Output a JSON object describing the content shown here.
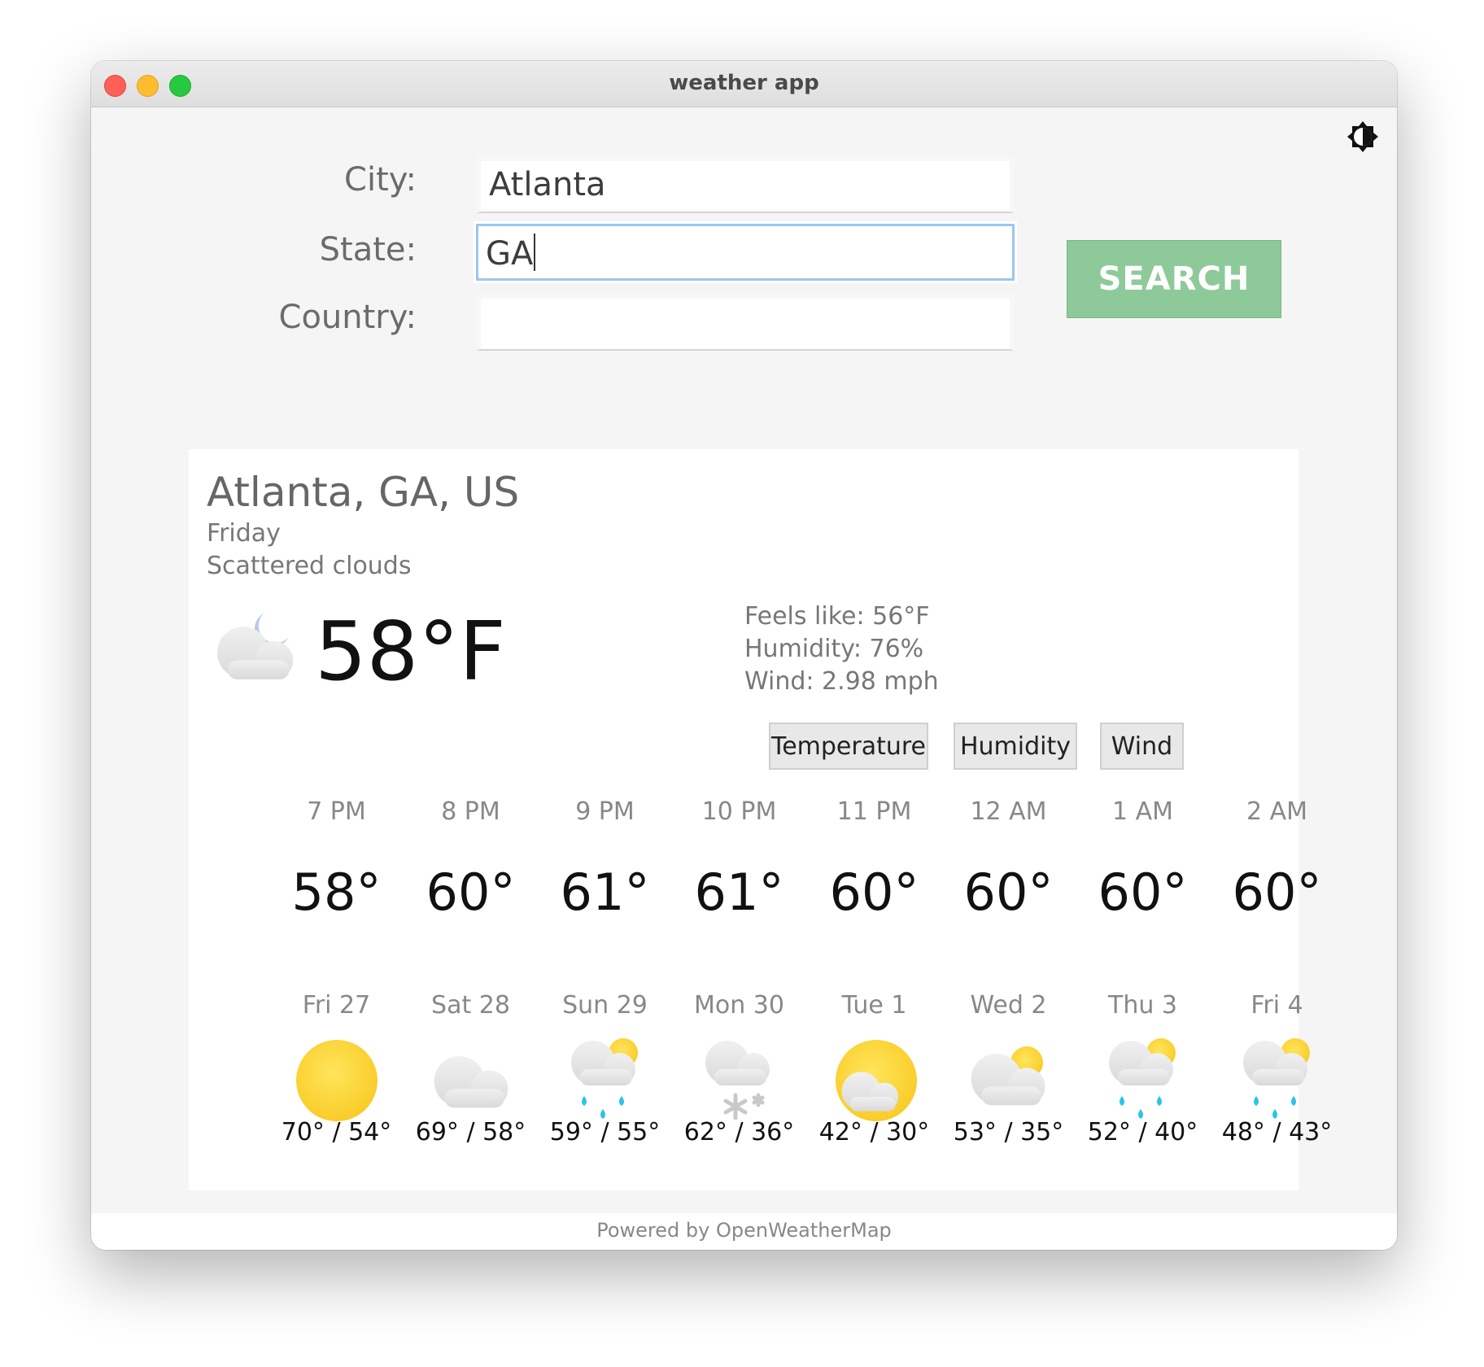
{
  "window": {
    "title": "weather app"
  },
  "form": {
    "city_label": "City:",
    "city_value": "Atlanta",
    "state_label": "State:",
    "state_value": "GA",
    "country_label": "Country:",
    "country_value": "",
    "search_label": "SEARCH"
  },
  "current": {
    "location": "Atlanta, GA, US",
    "day": "Friday",
    "condition": "Scattered clouds",
    "icon": "night-cloud-icon",
    "temp": "58°F",
    "feels_like": "Feels like: 56°F",
    "humidity": "Humidity: 76%",
    "wind": "Wind: 2.98 mph"
  },
  "tabs": [
    "Temperature",
    "Humidity",
    "Wind"
  ],
  "hourly": [
    {
      "time": "7 PM",
      "temp": "58°"
    },
    {
      "time": "8 PM",
      "temp": "60°"
    },
    {
      "time": "9 PM",
      "temp": "61°"
    },
    {
      "time": "10 PM",
      "temp": "61°"
    },
    {
      "time": "11 PM",
      "temp": "60°"
    },
    {
      "time": "12 AM",
      "temp": "60°"
    },
    {
      "time": "1 AM",
      "temp": "60°"
    },
    {
      "time": "2 AM",
      "temp": "60°"
    }
  ],
  "daily": [
    {
      "day": "Fri 27",
      "icon": "sun-icon",
      "range": "70° / 54°"
    },
    {
      "day": "Sat 28",
      "icon": "cloud-icon",
      "range": "69° / 58°"
    },
    {
      "day": "Sun 29",
      "icon": "rain-icon",
      "range": "59° / 55°"
    },
    {
      "day": "Mon 30",
      "icon": "snow-icon",
      "range": "62° / 36°"
    },
    {
      "day": "Tue 1",
      "icon": "sun-cloud-icon",
      "range": "42° / 30°"
    },
    {
      "day": "Wed 2",
      "icon": "partly-cloudy-icon",
      "range": "53° / 35°"
    },
    {
      "day": "Thu 3",
      "icon": "rain-icon",
      "range": "52° / 40°"
    },
    {
      "day": "Fri 4",
      "icon": "rain-icon",
      "range": "48° / 43°"
    }
  ],
  "footer": "Powered by OpenWeatherMap",
  "colors": {
    "search": "#8ec99a",
    "sun": "#fdd835",
    "rain": "#29c4e8",
    "cloud": "#e4e4e4"
  }
}
